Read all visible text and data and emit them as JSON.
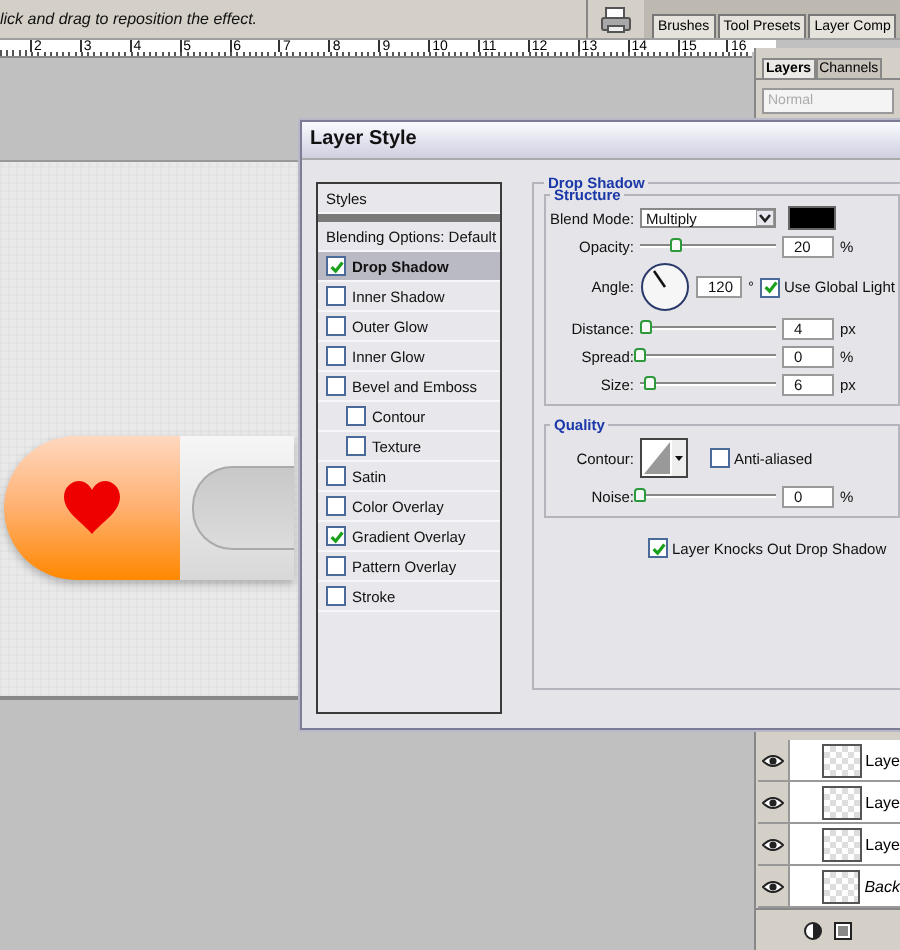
{
  "options_bar": {
    "hint": "lick and drag to reposition the effect."
  },
  "palette_well": {
    "tabs": [
      {
        "label": "Brushes",
        "selected": false
      },
      {
        "label": "Tool Presets",
        "selected": false
      },
      {
        "label": "Layer Comp",
        "selected": false
      }
    ]
  },
  "ruler": {
    "labels": [
      "2",
      "3",
      "4",
      "5",
      "6",
      "7",
      "8",
      "9",
      "10",
      "11",
      "12",
      "13",
      "14",
      "15",
      "16"
    ]
  },
  "layers_panel": {
    "tabs": [
      {
        "label": "Layers",
        "selected": true
      },
      {
        "label": "Channels",
        "selected": false
      }
    ],
    "blend_mode": {
      "value": "Normal",
      "disabled": true
    },
    "layers": [
      {
        "name": "Laye",
        "kind": "layer"
      },
      {
        "name": "Laye",
        "kind": "layer"
      },
      {
        "name": "Laye",
        "kind": "layer"
      },
      {
        "name": "Back",
        "kind": "background"
      }
    ]
  },
  "dialog": {
    "title": "Layer Style",
    "styles": {
      "header": "Styles",
      "blending": "Blending Options: Default",
      "items": [
        {
          "label": "Drop Shadow",
          "checked": true,
          "selected": true
        },
        {
          "label": "Inner Shadow",
          "checked": false,
          "selected": false
        },
        {
          "label": "Outer Glow",
          "checked": false,
          "selected": false
        },
        {
          "label": "Inner Glow",
          "checked": false,
          "selected": false
        },
        {
          "label": "Bevel and Emboss",
          "checked": false,
          "selected": false,
          "children": [
            {
              "label": "Contour",
              "checked": false,
              "selected": false
            },
            {
              "label": "Texture",
              "checked": false,
              "selected": false
            }
          ]
        },
        {
          "label": "Satin",
          "checked": false,
          "selected": false
        },
        {
          "label": "Color Overlay",
          "checked": false,
          "selected": false
        },
        {
          "label": "Gradient Overlay",
          "checked": true,
          "selected": false
        },
        {
          "label": "Pattern Overlay",
          "checked": false,
          "selected": false
        },
        {
          "label": "Stroke",
          "checked": false,
          "selected": false
        }
      ]
    },
    "effect": {
      "title": "Drop Shadow",
      "structure": {
        "title": "Structure",
        "blend_mode": {
          "label": "Blend Mode:",
          "value": "Multiply"
        },
        "rows": [
          {
            "kind": "slider",
            "label": "Opacity:",
            "level": 0.27,
            "value": "20",
            "unit": "%"
          },
          {
            "kind": "angle",
            "label": "Angle:",
            "value": "120",
            "unit": "°",
            "global_light": {
              "label": "Use Global Light",
              "checked": true
            }
          },
          {
            "kind": "slider",
            "label": "Distance:",
            "level": 0.05,
            "value": "4",
            "unit": "px"
          },
          {
            "kind": "slider",
            "label": "Spread:",
            "level": 0,
            "value": "0",
            "unit": "%"
          },
          {
            "kind": "slider",
            "label": "Size:",
            "level": 0.08,
            "value": "6",
            "unit": "px"
          }
        ]
      },
      "quality": {
        "title": "Quality",
        "contour": {
          "label": "Contour:",
          "anti_aliased": {
            "label": "Anti-aliased",
            "checked": false
          }
        },
        "noise": {
          "label": "Noise:",
          "level": 0,
          "value": "0",
          "unit": "%"
        }
      },
      "knockout": {
        "label": "Layer Knocks Out Drop Shadow",
        "checked": true
      }
    }
  }
}
